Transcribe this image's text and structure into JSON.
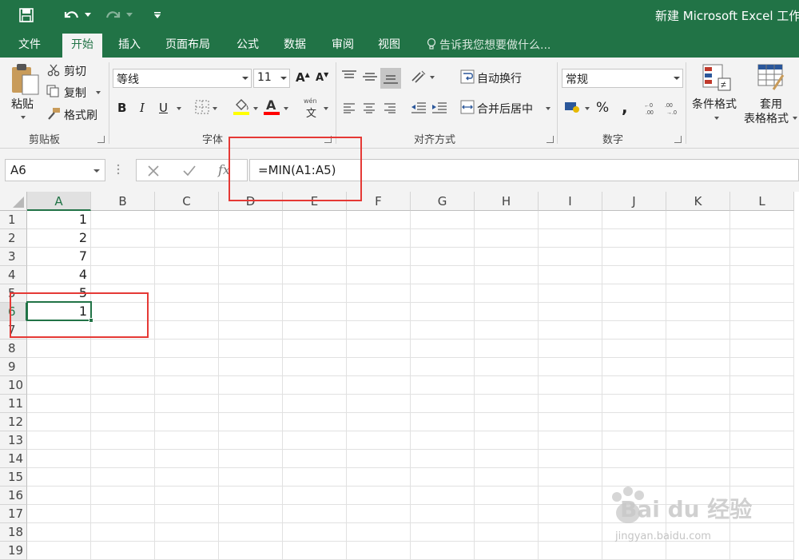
{
  "title_bar": {
    "title": "新建 Microsoft Excel 工作",
    "quick_access": [
      "save-icon",
      "undo-icon",
      "redo-icon",
      "customize-icon"
    ]
  },
  "tabs": [
    "文件",
    "开始",
    "插入",
    "页面布局",
    "公式",
    "数据",
    "审阅",
    "视图"
  ],
  "active_tab": "开始",
  "tell_me": "告诉我您想要做什么...",
  "clipboard": {
    "paste": "粘贴",
    "cut": "剪切",
    "copy": "复制",
    "format_painter": "格式刷",
    "label": "剪贴板"
  },
  "font": {
    "name": "等线",
    "size": "11",
    "label": "字体",
    "phonetic_top": "wén",
    "phonetic_char": "文",
    "bold": "B",
    "italic": "I",
    "underline": "U",
    "grow": "A",
    "shrink": "A",
    "color_glyph": "A",
    "fill_color": "#ffff00",
    "font_color": "#ff0000"
  },
  "alignment": {
    "wrap_text": "自动换行",
    "merge_center": "合并后居中",
    "label": "对齐方式"
  },
  "number": {
    "format": "常规",
    "percent": "%",
    "comma": ",",
    "label": "数字"
  },
  "styles": {
    "conditional_formatting": "条件格式",
    "format_as_table_line1": "套用",
    "format_as_table_line2": "表格格式"
  },
  "formula_bar": {
    "name_box": "A6",
    "formula": "=MIN(A1:A5)"
  },
  "sheet": {
    "columns": [
      "A",
      "B",
      "C",
      "D",
      "E",
      "F",
      "G",
      "H",
      "I",
      "J",
      "K",
      "L"
    ],
    "rows": [
      "1",
      "2",
      "3",
      "4",
      "5",
      "6",
      "7",
      "8",
      "9",
      "10",
      "11",
      "12",
      "13",
      "14",
      "15",
      "16",
      "17",
      "18",
      "19"
    ],
    "column_a_values": [
      "1",
      "2",
      "7",
      "4",
      "5",
      "1"
    ],
    "active_cell": "A6"
  },
  "watermark": {
    "brand": "Bai du 经验",
    "url": "jingyan.baidu.com"
  },
  "colors": {
    "excel_green": "#217346",
    "highlight_red": "#e53935"
  }
}
